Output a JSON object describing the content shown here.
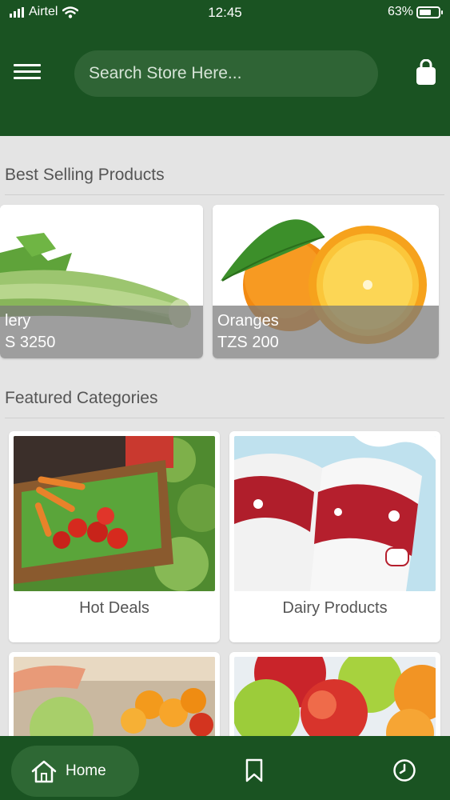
{
  "status_bar": {
    "carrier": "Airtel",
    "time": "12:45",
    "battery_percent": "63%",
    "battery_level": 0.63
  },
  "header": {
    "search_placeholder": "Search Store Here..."
  },
  "best_selling": {
    "title": "Best Selling Products",
    "items": [
      {
        "name": "lery",
        "price": "S 3250"
      },
      {
        "name": "Oranges",
        "price": "TZS 200"
      }
    ]
  },
  "featured": {
    "title": "Featured Categories",
    "items": [
      {
        "label": "Hot Deals"
      },
      {
        "label": "Dairy Products"
      }
    ]
  },
  "bottom_nav": {
    "home_label": "Home"
  },
  "colors": {
    "primary": "#1a5322",
    "search_bg": "#2f6435",
    "page_bg": "#e4e4e4"
  }
}
